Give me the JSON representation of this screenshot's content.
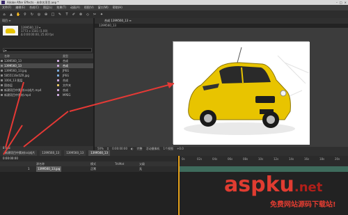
{
  "window": {
    "title": "Adobe After Effects - 未命名项目.aep *",
    "buttons": [
      "–",
      "□",
      "×"
    ]
  },
  "menu": [
    "文件(F)",
    "编辑(E)",
    "合成(C)",
    "图层(L)",
    "效果(T)",
    "动画(A)",
    "视图(V)",
    "窗口(W)",
    "帮助(H)"
  ],
  "toolbar_icons": [
    "home-icon",
    "selection-tool-icon",
    "hand-tool-icon",
    "zoom-tool-icon",
    "rotate-tool-icon",
    "camera-tool-icon",
    "pan-behind-icon",
    "rectangle-tool-icon",
    "pen-tool-icon",
    "type-tool-icon",
    "brush-tool-icon",
    "clone-tool-icon",
    "eraser-tool-icon",
    "roto-tool-icon",
    "puppet-tool-icon"
  ],
  "toolbar_glyphs": [
    "⌂",
    "▲",
    "✋",
    "⚲",
    "↻",
    "◎",
    "⊕",
    "□",
    "✎",
    "T",
    "✐",
    "⊗",
    "◇",
    "✂",
    "✦"
  ],
  "project": {
    "tab": "项目 ≡",
    "selected_name": "1399560_13 ▾",
    "info_lines": [
      "1773 x 1181 (1.00)",
      "Δ 0:00:00:00, 25.00 fps"
    ],
    "search_placeholder": "ρ▾",
    "columns": {
      "name": "名称",
      "type": "类型"
    },
    "items": [
      {
        "name": "1399560_13",
        "type": "合成",
        "color": "#c8a6d8",
        "selected": false
      },
      {
        "name": "1399560_13",
        "type": "合成",
        "color": "#c8a6d8",
        "selected": true
      },
      {
        "name": "1399560_13.jpg",
        "type": "JPEG",
        "color": "#7aa7d8",
        "selected": false
      },
      {
        "name": "5B55116e5ZR.jpg",
        "type": "JPEG",
        "color": "#7aa7d8",
        "selected": false
      },
      {
        "name": "1004_13 图层",
        "type": "合成",
        "color": "#c8a6d8",
        "selected": false
      },
      {
        "name": "固态层",
        "type": "文件夹",
        "color": "#e0c060",
        "selected": false
      },
      {
        "name": "新建项目中素材(ss)成片.mp4",
        "type": "合成",
        "color": "#c8a6d8",
        "selected": false
      },
      {
        "name": "新建项目中素材.mp4",
        "type": "MPEG",
        "color": "#c8a6d8",
        "selected": false
      }
    ],
    "footer": "8 bpc"
  },
  "composition": {
    "tab": "合成 1399560_13 ≡",
    "sub_tab": "1399560_13",
    "footer": [
      "50%",
      "⌗",
      "0:00:00:00",
      "◐",
      "完整",
      "活动摄像机",
      "1个视图",
      "+0.0"
    ]
  },
  "timeline": {
    "tabs": [
      {
        "label": "新建项目中素材(ss)成片",
        "active": false
      },
      {
        "label": "1399560_13",
        "active": false
      },
      {
        "label": "1399560_13",
        "active": false
      },
      {
        "label": "1399560_13",
        "active": true
      }
    ],
    "timecode": "0:00:00:00",
    "columns": {
      "source": "源名称",
      "mode": "模式",
      "trkmat": "TrkMat",
      "parent": "父级"
    },
    "layer": {
      "index": "1",
      "name": "1399560_13.jpg",
      "mode": "正常",
      "parent": "无"
    },
    "ruler_ticks": [
      "0s",
      "02s",
      "04s",
      "06s",
      "08s",
      "10s",
      "12s",
      "14s",
      "16s",
      "18s",
      "20s"
    ]
  },
  "watermark": {
    "main": "aspku",
    "suffix": ".net",
    "sub": "免费网站源码下载站!"
  },
  "colors": {
    "arrow": "#e53935",
    "car": "#e8c400",
    "timeline_bar": "#3e6b5c",
    "cti": "#e6a21c"
  }
}
